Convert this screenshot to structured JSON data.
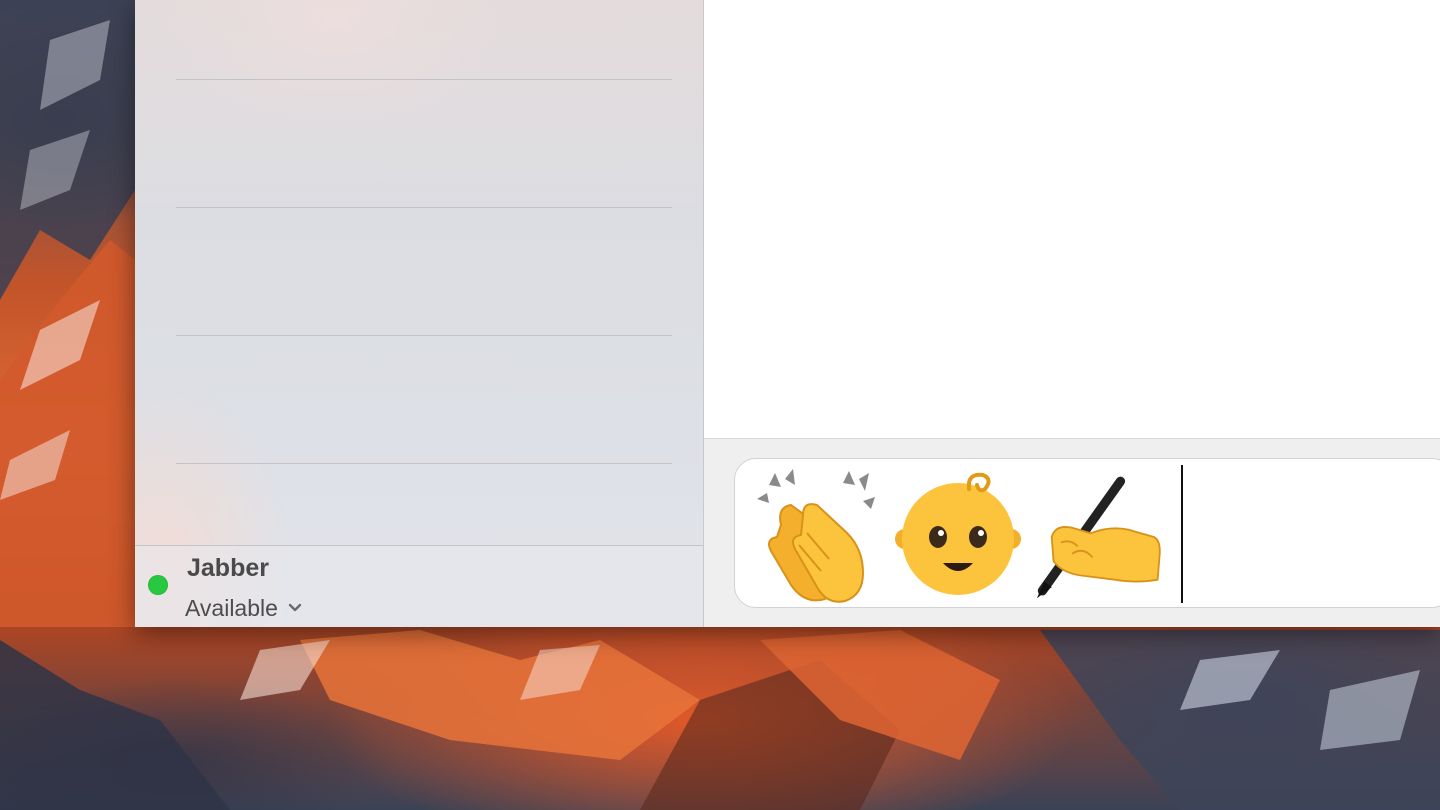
{
  "account": {
    "name": "Jabber",
    "status": "Available",
    "status_color": "#28c840",
    "status_icon": "status-dot",
    "dropdown_icon": "chevron-down-icon"
  },
  "sidebar": {
    "rows": [
      {
        "text": ""
      },
      {
        "text": ""
      },
      {
        "text": ""
      },
      {
        "text": ""
      }
    ]
  },
  "compose": {
    "emojis": [
      "👏",
      "👶",
      "✍️"
    ],
    "emoji_icons": [
      "clapping-hands-emoji",
      "baby-emoji",
      "writing-hand-emoji"
    ]
  },
  "colors": {
    "sidebar_bg": "#dfdfe4",
    "chat_bg": "#ffffff",
    "input_bar_bg": "#efefef"
  }
}
